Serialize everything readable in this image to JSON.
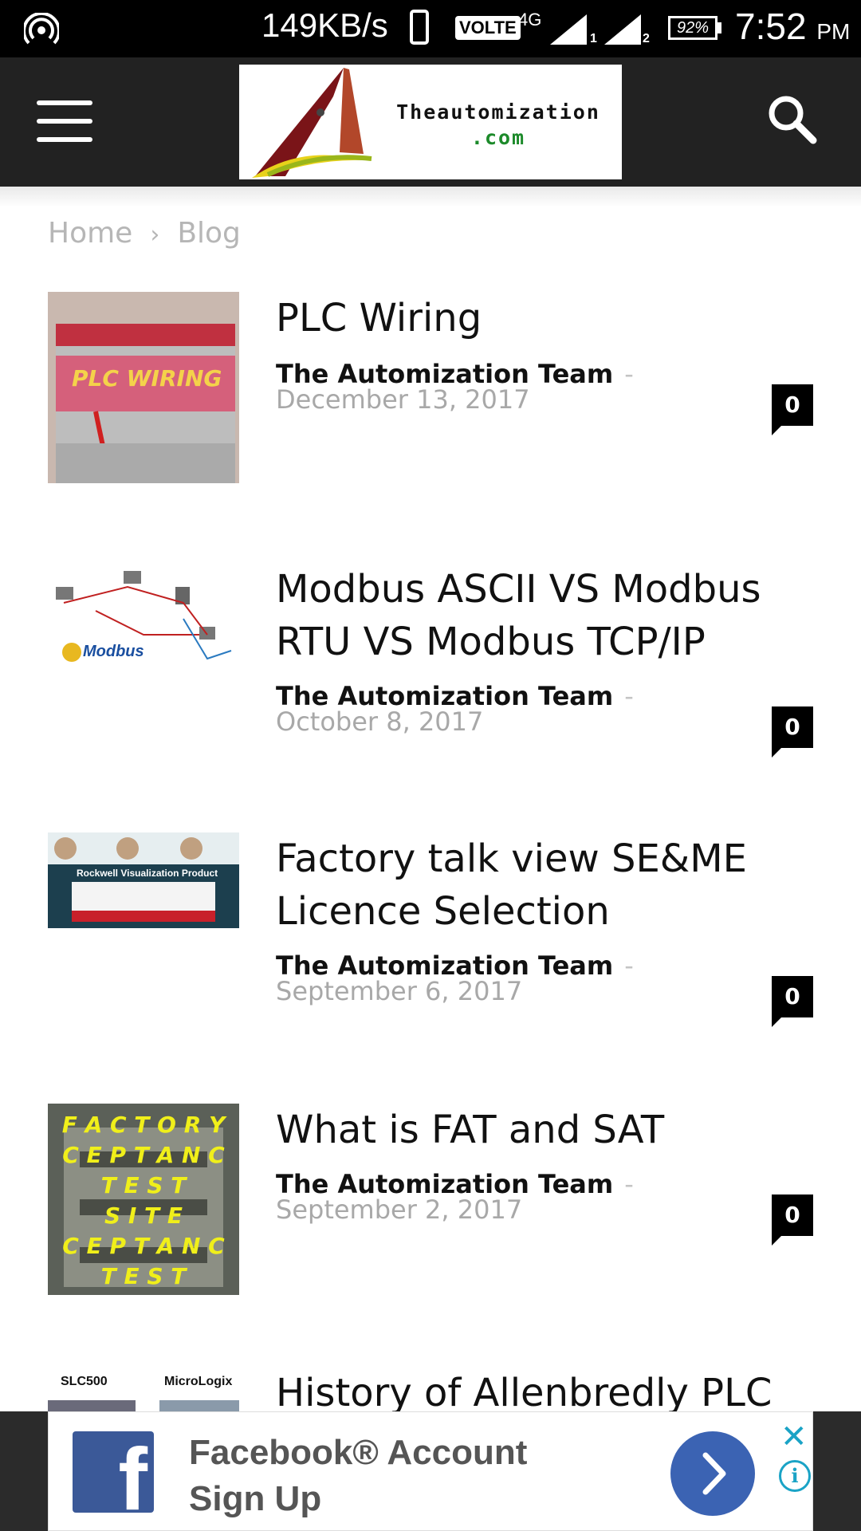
{
  "status_bar": {
    "speed": "149KB/s",
    "volte": "VOLTE",
    "network": "4G",
    "sim1": "1",
    "sim2": "2",
    "battery": "92%",
    "time": "7:52",
    "ampm": "PM",
    "icons": [
      "hotspot-icon",
      "phone-icon",
      "signal-icon",
      "battery-icon"
    ]
  },
  "header": {
    "logo_line1": "Theautomization",
    "logo_line2": ".com",
    "icons": [
      "menu-icon",
      "search-icon"
    ]
  },
  "breadcrumb": {
    "home": "Home",
    "separator": "›",
    "current": "Blog"
  },
  "posts": [
    {
      "title": "PLC Wiring",
      "author": "The Automization Team",
      "separator": "-",
      "date": "December 13, 2017",
      "comments": "0",
      "thumb_label": "PLC WIRING"
    },
    {
      "title": "Modbus ASCII VS Modbus RTU VS Modbus TCP/IP",
      "author": "The Automization Team",
      "separator": "-",
      "date": "October 8, 2017",
      "comments": "0",
      "thumb_label": "Modbus"
    },
    {
      "title": "Factory talk view SE&ME Licence Selection",
      "author": "The Automization Team",
      "separator": "-",
      "date": "September 6, 2017",
      "comments": "0",
      "thumb_label": "Rockwell Visualization Product"
    },
    {
      "title": "What is FAT and SAT",
      "author": "The Automization Team",
      "separator": "-",
      "date": "September 2, 2017",
      "comments": "0",
      "thumb_lines": [
        "F A C T O R Y",
        "C E P T A N C",
        "T E S T",
        "S I T E",
        "C E P T A N C",
        "T E S T"
      ]
    },
    {
      "title": "History of Allenbredly PLC",
      "thumb_labels": [
        "SLC500",
        "MicroLogix"
      ]
    }
  ],
  "ad": {
    "text": "Facebook® Account Sign Up",
    "close": "✕",
    "info": "i",
    "icons": [
      "facebook-icon",
      "chevron-right-icon",
      "close-icon",
      "info-icon"
    ]
  }
}
